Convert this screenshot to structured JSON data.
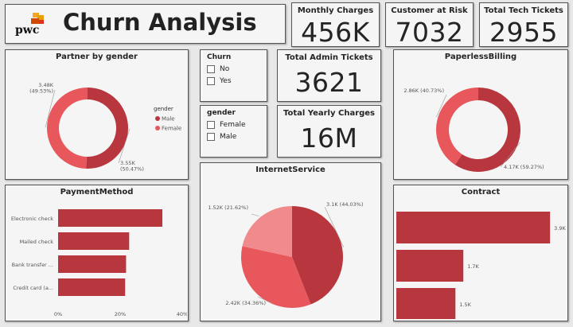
{
  "header": {
    "logo_text": "pwc",
    "title": "Churn Analysis"
  },
  "kpis": {
    "monthly_charges": {
      "label": "Monthly Charges",
      "value": "456K"
    },
    "customer_at_risk": {
      "label": "Customer at Risk",
      "value": "7032"
    },
    "total_tech_tickets": {
      "label": "Total Tech Tickets",
      "value": "2955"
    },
    "total_admin_tickets": {
      "label": "Total Admin Tickets",
      "value": "3621"
    },
    "total_yearly_charges": {
      "label": "Total Yearly Charges",
      "value": "16M"
    }
  },
  "slicers": {
    "churn": {
      "title": "Churn",
      "options": [
        "No",
        "Yes"
      ]
    },
    "gender": {
      "title": "gender",
      "options": [
        "Female",
        "Male"
      ]
    }
  },
  "colors": {
    "dark": "#b8373e",
    "mid": "#e8575c",
    "light": "#f08a8d"
  },
  "chart_data": [
    {
      "id": "partner_by_gender",
      "type": "pie",
      "title": "Partner by gender",
      "legend_title": "gender",
      "legend_position": "right",
      "slices": [
        {
          "name": "Male",
          "value": 3550,
          "label": "3.55K\n(50.47%)",
          "color": "#b8373e"
        },
        {
          "name": "Female",
          "value": 3480,
          "label": "3.48K\n(49.53%)",
          "color": "#e8575c"
        }
      ]
    },
    {
      "id": "paperless_billing",
      "type": "pie",
      "title": "PaperlessBilling",
      "slices": [
        {
          "value": 4170,
          "label": "4.17K (59.27%)",
          "color": "#b8373e"
        },
        {
          "value": 2860,
          "label": "2.86K (40.73%)",
          "color": "#e8575c"
        }
      ]
    },
    {
      "id": "internet_service",
      "type": "pie",
      "title": "InternetService",
      "slices": [
        {
          "value": 3100,
          "label": "3.1K (44.03%)",
          "color": "#b8373e"
        },
        {
          "value": 2420,
          "label": "2.42K (34.36%)",
          "color": "#e8575c"
        },
        {
          "value": 1520,
          "label": "1.52K (21.62%)",
          "color": "#f08a8d"
        }
      ]
    },
    {
      "id": "payment_method",
      "type": "bar",
      "title": "PaymentMethod",
      "orientation": "horizontal",
      "categories": [
        "Electronic check",
        "Mailed check",
        "Bank transfer ...",
        "Credit card (a..."
      ],
      "values": [
        33.6,
        22.9,
        21.9,
        21.6
      ],
      "xticks": [
        "0%",
        "20%",
        "40%"
      ],
      "xlim": [
        0,
        40
      ]
    },
    {
      "id": "contract",
      "type": "bar",
      "title": "Contract",
      "orientation": "horizontal",
      "values": [
        3900,
        1700,
        1500
      ],
      "data_labels": [
        "3.9K",
        "1.7K",
        "1.5K"
      ],
      "xlim": [
        0,
        4200
      ]
    }
  ]
}
